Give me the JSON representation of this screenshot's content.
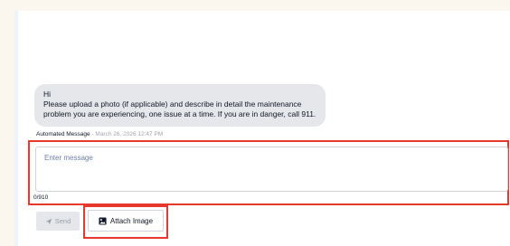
{
  "message": {
    "lines": [
      "Hi",
      "Please upload a photo (if applicable) and describe in detail the maintenance",
      "problem you are experiencing, one issue at a time. If you are in danger, call 911."
    ],
    "sender_label": "Automated Message",
    "separator": " - ",
    "timestamp": "March 26, 2026 12:47 PM"
  },
  "composer": {
    "placeholder": "Enter message",
    "value": "",
    "char_count": "0/910"
  },
  "actions": {
    "send_label": "Send",
    "send_icon": "send-icon",
    "attach_label": "Attach Image",
    "attach_icon": "image-icon"
  },
  "colors": {
    "background": "#fbf7ef",
    "bubble": "#e6e7ea",
    "highlight": "#e8372c",
    "placeholder": "#6d7fa8",
    "disabled_text": "#9aa0aa"
  }
}
